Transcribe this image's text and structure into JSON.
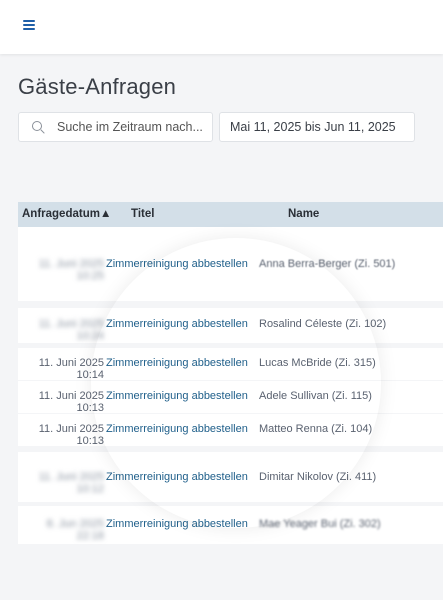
{
  "search": {
    "placeholder": "Suche im Zeitraum nach..."
  },
  "date_range": "Mai 11, 2025 bis Jun 11, 2025",
  "page_title": "Gäste-Anfragen",
  "table": {
    "headers": [
      "Anfragedatum▲",
      "Titel",
      "Name"
    ],
    "rows": [
      {
        "date": "11. Juni 2025 10:25",
        "title": "Zimmerreinigung abbestellen",
        "name": "Anna Berra-Berger (Zi. 501)"
      },
      {
        "date": "11. Juni 2025 10:24",
        "title": "Zimmerreinigung abbestellen",
        "name": "Rosalind Céleste (Zi. 102)"
      },
      {
        "date": "11. Juni 2025 10:14",
        "title": "Zimmerreinigung abbestellen",
        "name": "Lucas McBride (Zi. 315)"
      },
      {
        "date": "11. Juni 2025 10:13",
        "title": "Zimmerreinigung abbestellen",
        "name": "Adele Sullivan (Zi. 115)"
      },
      {
        "date": "11. Juni 2025 10:13",
        "title": "Zimmerreinigung abbestellen",
        "name": "Matteo Renna (Zi. 104)"
      },
      {
        "date": "11. Juni 2025 10:12",
        "title": "Zimmerreinigung abbestellen",
        "name": "Dimitar Nikolov (Zi. 411)"
      },
      {
        "date": "8. Jun 2025 22:18",
        "title": "Zimmerreinigung abbestellen",
        "name": "Mae Yeager Bui (Zi. 302)"
      }
    ]
  }
}
